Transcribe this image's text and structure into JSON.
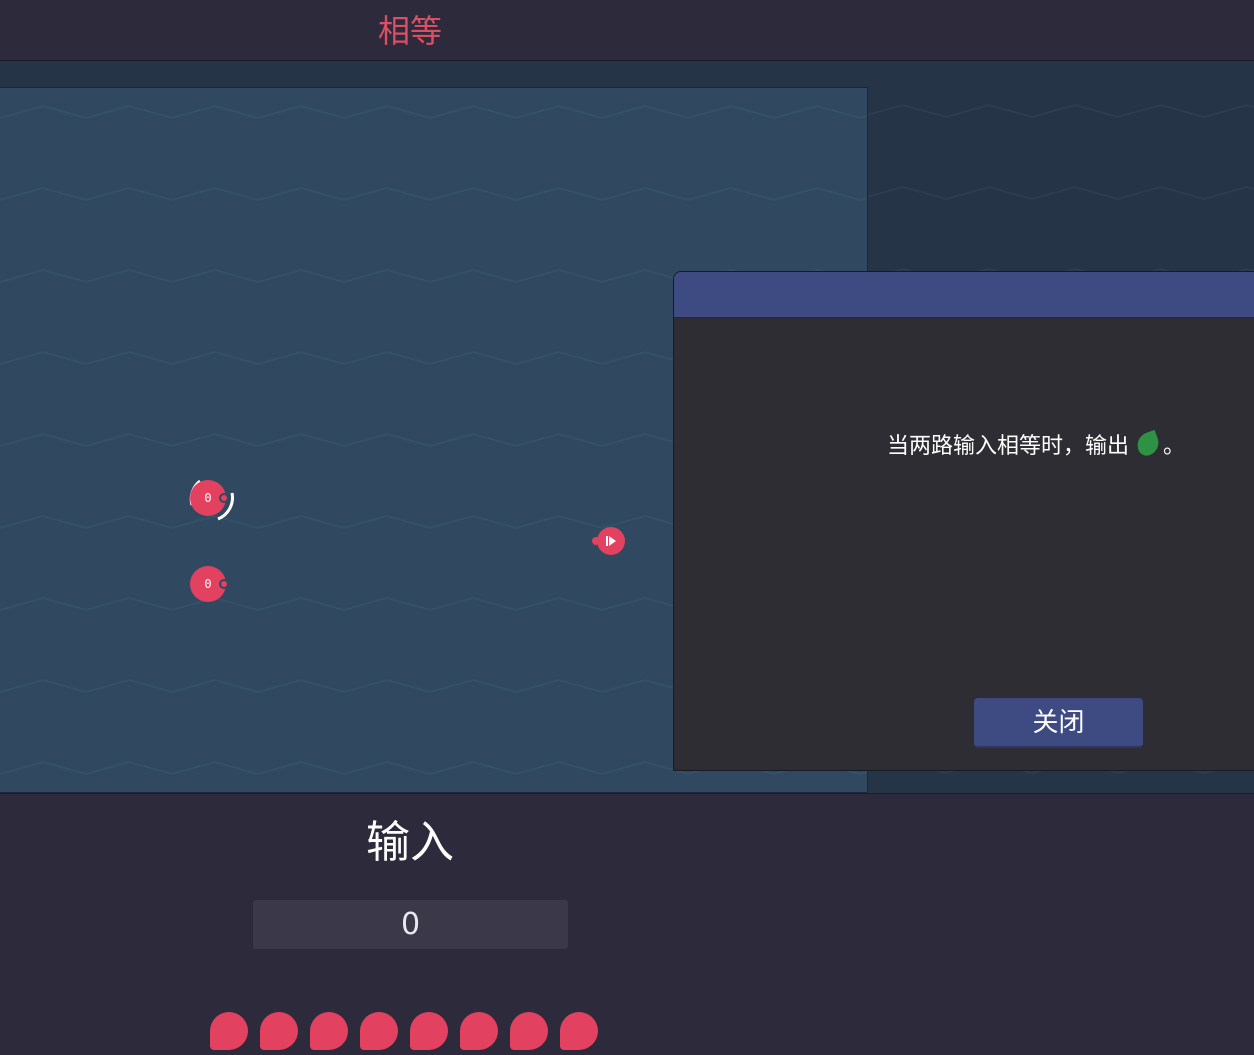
{
  "header": {
    "title": "相等"
  },
  "board": {
    "inputs": [
      {
        "value": "0",
        "selected": true
      },
      {
        "value": "0",
        "selected": false
      }
    ],
    "output_icon": "play-icon"
  },
  "dialog": {
    "text_before": "当两路输入相等时，输出",
    "text_after": "。",
    "icon": "green-leaf-icon",
    "close_label": "关闭"
  },
  "input_panel": {
    "title": "输入",
    "value": "0",
    "token_count": 8
  },
  "colors": {
    "accent": "#d94f63",
    "node": "#e34160",
    "dialog_title": "#3e4a82",
    "leaf": "#2e9245"
  }
}
